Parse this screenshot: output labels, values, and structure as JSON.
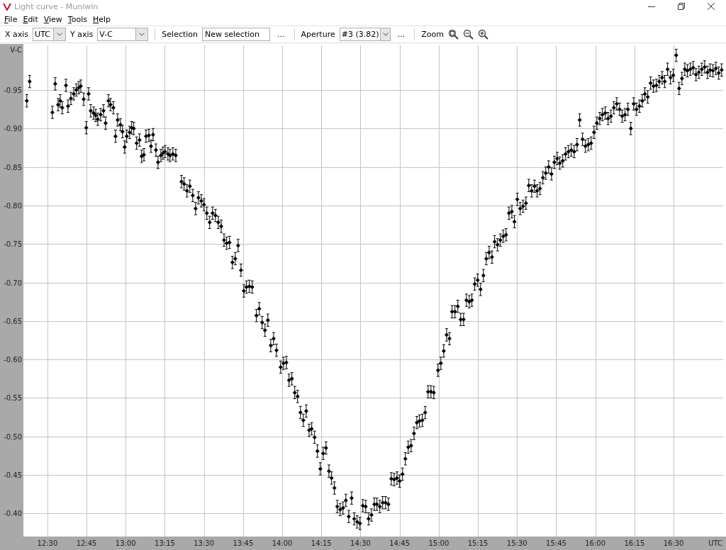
{
  "window": {
    "title": "Light curve - Muniwin"
  },
  "menu": [
    {
      "label": "File"
    },
    {
      "label": "Edit"
    },
    {
      "label": "View"
    },
    {
      "label": "Tools"
    },
    {
      "label": "Help"
    }
  ],
  "toolbar": [
    {
      "kind": "label",
      "text": "X axis"
    },
    {
      "kind": "combo",
      "value": "UTC"
    },
    {
      "kind": "label",
      "text": "Y axis"
    },
    {
      "kind": "combo",
      "value": "V-C"
    },
    {
      "kind": "separator"
    },
    {
      "kind": "label",
      "text": "Selection"
    },
    {
      "kind": "field",
      "value": "New selection"
    },
    {
      "kind": "button",
      "text": "..."
    },
    {
      "kind": "separator"
    },
    {
      "kind": "label",
      "text": "Aperture"
    },
    {
      "kind": "combo",
      "value": "#3 (3.82)"
    },
    {
      "kind": "button",
      "text": "..."
    },
    {
      "kind": "separator"
    },
    {
      "kind": "zoom",
      "text": "Zoom"
    }
  ],
  "chart": {
    "chart_data": {
      "type": "scatter",
      "xlabel": "UTC",
      "ylabel": "V-C",
      "xlim": [
        740.8,
        1009
      ],
      "ylim": [
        -0.37,
        -1.008
      ],
      "grid": true,
      "xticks": [
        {
          "value": 750,
          "label": "12:30"
        },
        {
          "value": 765,
          "label": "12:45"
        },
        {
          "value": 780,
          "label": "13:00"
        },
        {
          "value": 795,
          "label": "13:15"
        },
        {
          "value": 810,
          "label": "13:30"
        },
        {
          "value": 825,
          "label": "13:45"
        },
        {
          "value": 840,
          "label": "14:00"
        },
        {
          "value": 855,
          "label": "14:15"
        },
        {
          "value": 870,
          "label": "14:30"
        },
        {
          "value": 885,
          "label": "14:45"
        },
        {
          "value": 900,
          "label": "15:00"
        },
        {
          "value": 915,
          "label": "15:15"
        },
        {
          "value": 930,
          "label": "15:30"
        },
        {
          "value": 945,
          "label": "15:45"
        },
        {
          "value": 960,
          "label": "16:00"
        },
        {
          "value": 975,
          "label": "16:15"
        },
        {
          "value": 990,
          "label": "16:30"
        }
      ],
      "yticks": [
        {
          "value": -0.95,
          "label": "-0.95"
        },
        {
          "value": -0.9,
          "label": "-0.90"
        },
        {
          "value": -0.85,
          "label": "-0.85"
        },
        {
          "value": -0.8,
          "label": "-0.80"
        },
        {
          "value": -0.75,
          "label": "-0.75"
        },
        {
          "value": -0.7,
          "label": "-0.70"
        },
        {
          "value": -0.65,
          "label": "-0.65"
        },
        {
          "value": -0.6,
          "label": "-0.60"
        },
        {
          "value": -0.55,
          "label": "-0.55"
        },
        {
          "value": -0.5,
          "label": "-0.50"
        },
        {
          "value": -0.45,
          "label": "-0.45"
        },
        {
          "value": -0.4,
          "label": "-0.40"
        }
      ],
      "x": [
        742.1,
        743.2,
        751.9,
        753.0,
        754.1,
        754.9,
        755.7,
        757.1,
        757.9,
        759.0,
        760.1,
        761.1,
        762.0,
        762.8,
        763.9,
        764.9,
        765.8,
        766.6,
        767.7,
        768.5,
        769.3,
        770.4,
        771.5,
        772.3,
        773.4,
        774.2,
        775.3,
        776.1,
        776.9,
        778.0,
        778.8,
        779.6,
        780.4,
        781.5,
        782.3,
        783.1,
        784.2,
        785.3,
        786.1,
        787.0,
        787.8,
        788.9,
        789.7,
        790.5,
        791.6,
        792.4,
        793.5,
        794.3,
        795.1,
        796.2,
        797.0,
        798.1,
        799.2,
        801.4,
        802.4,
        803.5,
        804.6,
        805.7,
        806.8,
        807.9,
        809.0,
        810.0,
        811.1,
        812.2,
        813.3,
        814.4,
        815.5,
        816.6,
        817.7,
        818.7,
        819.8,
        820.9,
        822.0,
        823.1,
        824.2,
        825.3,
        826.3,
        827.4,
        828.5,
        830.1,
        831.2,
        832.3,
        833.4,
        834.5,
        835.6,
        836.7,
        837.8,
        839.4,
        840.5,
        841.6,
        842.6,
        843.7,
        844.8,
        845.9,
        847.0,
        848.1,
        849.2,
        850.3,
        851.3,
        852.4,
        853.5,
        854.6,
        855.7,
        856.8,
        857.9,
        858.9,
        860.0,
        861.1,
        862.2,
        863.3,
        864.4,
        865.5,
        866.6,
        867.6,
        868.7,
        869.8,
        870.9,
        872.0,
        873.1,
        874.2,
        875.3,
        876.3,
        877.4,
        878.5,
        879.6,
        880.7,
        881.8,
        882.9,
        884.0,
        885.0,
        886.1,
        887.2,
        888.3,
        889.4,
        890.5,
        891.6,
        892.6,
        893.7,
        894.8,
        895.9,
        897.0,
        898.1,
        899.7,
        900.8,
        901.9,
        903.0,
        904.1,
        905.1,
        906.2,
        907.3,
        908.4,
        909.5,
        910.6,
        911.7,
        912.7,
        913.8,
        914.9,
        916.0,
        917.1,
        918.2,
        919.3,
        920.4,
        921.4,
        922.5,
        923.6,
        924.7,
        925.8,
        926.9,
        928.0,
        929.0,
        930.1,
        931.2,
        932.3,
        933.4,
        934.5,
        935.6,
        936.7,
        937.7,
        938.8,
        939.9,
        941.0,
        942.1,
        943.2,
        944.3,
        945.4,
        946.4,
        947.5,
        948.6,
        949.7,
        950.8,
        951.9,
        953.0,
        954.0,
        955.1,
        956.2,
        957.3,
        958.4,
        959.5,
        960.6,
        961.7,
        962.7,
        963.8,
        964.9,
        966.0,
        967.1,
        968.2,
        969.3,
        970.3,
        971.4,
        972.5,
        973.6,
        974.7,
        975.8,
        976.9,
        978.0,
        979.0,
        980.1,
        981.2,
        982.3,
        983.4,
        984.5,
        985.6,
        986.6,
        987.7,
        988.8,
        989.9,
        991.0,
        992.1,
        993.2,
        994.3,
        995.3,
        996.4,
        997.5,
        998.6,
        999.7,
        1000.8,
        1001.9,
        1003.0,
        1004.0,
        1005.1,
        1006.2,
        1007.3,
        1008.4
      ],
      "series": [
        {
          "color": "#000000",
          "errors": [
            0.008,
            0.008,
            0.008,
            0.008,
            0.008,
            0.008,
            0.008,
            0.008,
            0.008,
            0.008,
            0.008,
            0.008,
            0.008,
            0.008,
            0.008,
            0.008,
            0.008,
            0.008,
            0.008,
            0.008,
            0.008,
            0.008,
            0.008,
            0.008,
            0.008,
            0.008,
            0.008,
            0.008,
            0.008,
            0.008,
            0.008,
            0.008,
            0.008,
            0.008,
            0.008,
            0.008,
            0.008,
            0.008,
            0.008,
            0.008,
            0.008,
            0.008,
            0.008,
            0.008,
            0.008,
            0.008,
            0.008,
            0.008,
            0.008,
            0.008,
            0.008,
            0.008,
            0.008,
            0.008,
            0.008,
            0.008,
            0.008,
            0.008,
            0.008,
            0.008,
            0.008,
            0.008,
            0.008,
            0.008,
            0.008,
            0.008,
            0.008,
            0.008,
            0.008,
            0.008,
            0.008,
            0.008,
            0.008,
            0.008,
            0.008,
            0.008,
            0.008,
            0.008,
            0.008,
            0.008,
            0.008,
            0.008,
            0.008,
            0.008,
            0.008,
            0.008,
            0.008,
            0.008,
            0.008,
            0.008,
            0.008,
            0.008,
            0.008,
            0.008,
            0.008,
            0.008,
            0.008,
            0.008,
            0.008,
            0.008,
            0.008,
            0.008,
            0.008,
            0.008,
            0.008,
            0.008,
            0.008,
            0.008,
            0.008,
            0.008,
            0.008,
            0.008,
            0.008,
            0.008,
            0.008,
            0.008,
            0.008,
            0.008,
            0.008,
            0.008,
            0.008,
            0.008,
            0.008,
            0.008,
            0.008,
            0.008,
            0.008,
            0.008,
            0.008,
            0.008,
            0.008,
            0.008,
            0.008,
            0.008,
            0.008,
            0.008,
            0.008,
            0.008,
            0.008,
            0.008,
            0.008,
            0.008,
            0.008,
            0.008,
            0.008,
            0.008,
            0.008,
            0.008,
            0.008,
            0.008,
            0.008,
            0.008,
            0.008,
            0.008,
            0.008,
            0.008,
            0.008,
            0.008,
            0.008,
            0.008,
            0.008,
            0.008,
            0.008,
            0.008,
            0.008,
            0.008,
            0.008,
            0.008,
            0.008,
            0.008,
            0.008,
            0.008,
            0.008,
            0.008,
            0.008,
            0.008,
            0.008,
            0.008,
            0.008,
            0.008,
            0.008,
            0.008,
            0.008,
            0.008,
            0.008,
            0.008,
            0.008,
            0.008,
            0.008,
            0.008,
            0.008,
            0.008,
            0.008,
            0.008,
            0.008,
            0.008,
            0.008,
            0.008,
            0.008,
            0.008,
            0.008,
            0.008,
            0.008,
            0.008,
            0.008,
            0.008,
            0.008,
            0.008,
            0.008,
            0.008,
            0.008,
            0.008,
            0.008,
            0.008,
            0.008,
            0.008,
            0.008,
            0.008,
            0.008,
            0.008,
            0.008,
            0.008,
            0.008,
            0.008,
            0.008,
            0.008,
            0.008,
            0.008,
            0.008,
            0.008,
            0.008,
            0.008,
            0.008,
            0.008,
            0.008,
            0.008,
            0.008,
            0.008,
            0.008,
            0.008,
            0.008,
            0.008,
            0.008
          ],
          "values": [
            -0.936,
            -0.961,
            -0.921,
            -0.958,
            -0.931,
            -0.936,
            -0.927,
            -0.956,
            -0.929,
            -0.939,
            -0.945,
            -0.95,
            -0.953,
            -0.955,
            -0.938,
            -0.901,
            -0.945,
            -0.923,
            -0.92,
            -0.917,
            -0.912,
            -0.918,
            -0.923,
            -0.907,
            -0.936,
            -0.931,
            -0.927,
            -0.89,
            -0.911,
            -0.905,
            -0.896,
            -0.876,
            -0.89,
            -0.895,
            -0.901,
            -0.9,
            -0.881,
            -0.885,
            -0.864,
            -0.866,
            -0.89,
            -0.891,
            -0.877,
            -0.892,
            -0.872,
            -0.856,
            -0.865,
            -0.868,
            -0.87,
            -0.867,
            -0.865,
            -0.867,
            -0.865,
            -0.831,
            -0.828,
            -0.819,
            -0.825,
            -0.813,
            -0.796,
            -0.81,
            -0.806,
            -0.801,
            -0.79,
            -0.778,
            -0.79,
            -0.787,
            -0.778,
            -0.773,
            -0.755,
            -0.751,
            -0.752,
            -0.726,
            -0.731,
            -0.748,
            -0.716,
            -0.689,
            -0.694,
            -0.695,
            -0.694,
            -0.657,
            -0.666,
            -0.648,
            -0.638,
            -0.651,
            -0.618,
            -0.627,
            -0.612,
            -0.59,
            -0.595,
            -0.596,
            -0.573,
            -0.575,
            -0.557,
            -0.552,
            -0.531,
            -0.521,
            -0.533,
            -0.508,
            -0.51,
            -0.499,
            -0.481,
            -0.458,
            -0.478,
            -0.485,
            -0.455,
            -0.446,
            -0.433,
            -0.409,
            -0.405,
            -0.407,
            -0.417,
            -0.396,
            -0.42,
            -0.393,
            -0.389,
            -0.387,
            -0.41,
            -0.409,
            -0.393,
            -0.398,
            -0.412,
            -0.412,
            -0.409,
            -0.414,
            -0.414,
            -0.412,
            -0.445,
            -0.444,
            -0.446,
            -0.442,
            -0.451,
            -0.471,
            -0.486,
            -0.488,
            -0.504,
            -0.518,
            -0.52,
            -0.521,
            -0.531,
            -0.558,
            -0.558,
            -0.557,
            -0.586,
            -0.595,
            -0.611,
            -0.632,
            -0.627,
            -0.662,
            -0.662,
            -0.669,
            -0.652,
            -0.652,
            -0.677,
            -0.675,
            -0.677,
            -0.698,
            -0.703,
            -0.691,
            -0.709,
            -0.731,
            -0.739,
            -0.733,
            -0.753,
            -0.749,
            -0.755,
            -0.76,
            -0.762,
            -0.79,
            -0.792,
            -0.779,
            -0.808,
            -0.796,
            -0.799,
            -0.803,
            -0.826,
            -0.819,
            -0.825,
            -0.819,
            -0.822,
            -0.836,
            -0.842,
            -0.85,
            -0.841,
            -0.856,
            -0.861,
            -0.855,
            -0.858,
            -0.867,
            -0.87,
            -0.872,
            -0.87,
            -0.879,
            -0.911,
            -0.886,
            -0.877,
            -0.879,
            -0.881,
            -0.895,
            -0.907,
            -0.913,
            -0.918,
            -0.92,
            -0.913,
            -0.916,
            -0.927,
            -0.932,
            -0.925,
            -0.916,
            -0.918,
            -0.925,
            -0.9,
            -0.932,
            -0.925,
            -0.929,
            -0.936,
            -0.945,
            -0.941,
            -0.959,
            -0.955,
            -0.956,
            -0.961,
            -0.966,
            -0.961,
            -0.977,
            -0.966,
            -0.969,
            -0.995,
            -0.952,
            -0.965,
            -0.977,
            -0.975,
            -0.977,
            -0.979,
            -0.97,
            -0.973,
            -0.977,
            -0.98,
            -0.973,
            -0.976,
            -0.975,
            -0.978,
            -0.972,
            -0.976
          ]
        }
      ]
    }
  }
}
